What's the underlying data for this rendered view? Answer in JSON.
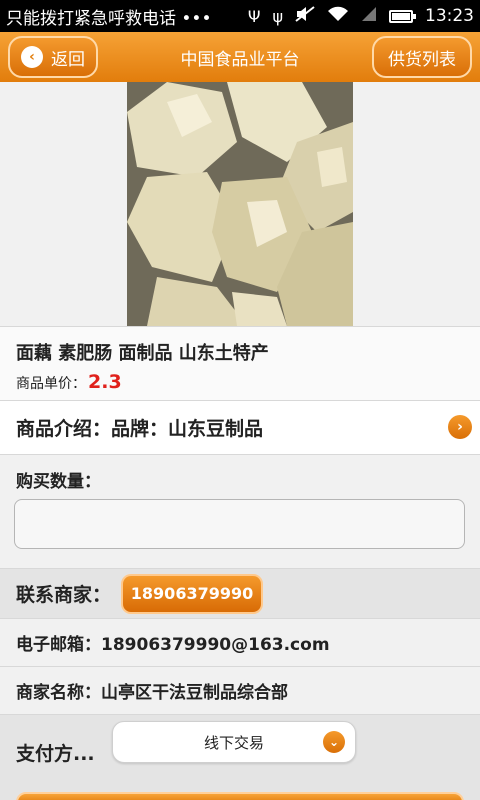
{
  "status_bar": {
    "carrier_text": "只能拨打紧急呼救电话",
    "dots": "•••",
    "time": "13:23",
    "icons": [
      "usb-icon",
      "usb-debug-icon",
      "mute-icon",
      "wifi-icon",
      "signal-icon",
      "battery-icon"
    ]
  },
  "header": {
    "back_label": "返回",
    "title": "中国食品业平台",
    "supply_list_label": "供货列表"
  },
  "product": {
    "image_semantic": "product-photo-mian-jin",
    "title": "面藕 素肥肠 面制品 山东土特产",
    "price_label": "商品单价：",
    "price_value": "2.3",
    "intro": "商品介绍：品牌：山东豆制品"
  },
  "purchase": {
    "quantity_label": "购买数量：",
    "quantity_value": "",
    "quantity_placeholder": ""
  },
  "contact": {
    "label": "联系商家：",
    "phone": "18906379990",
    "email_line": "电子邮箱：18906379990@163.com",
    "merchant_line": "商家名称：山亭区干法豆制品综合部"
  },
  "payment": {
    "label": "支付方...",
    "selected": "线下交易"
  },
  "colors": {
    "accent": "#e27d0c",
    "price": "#e0211b",
    "header_gradient_top": "#f6a236"
  }
}
